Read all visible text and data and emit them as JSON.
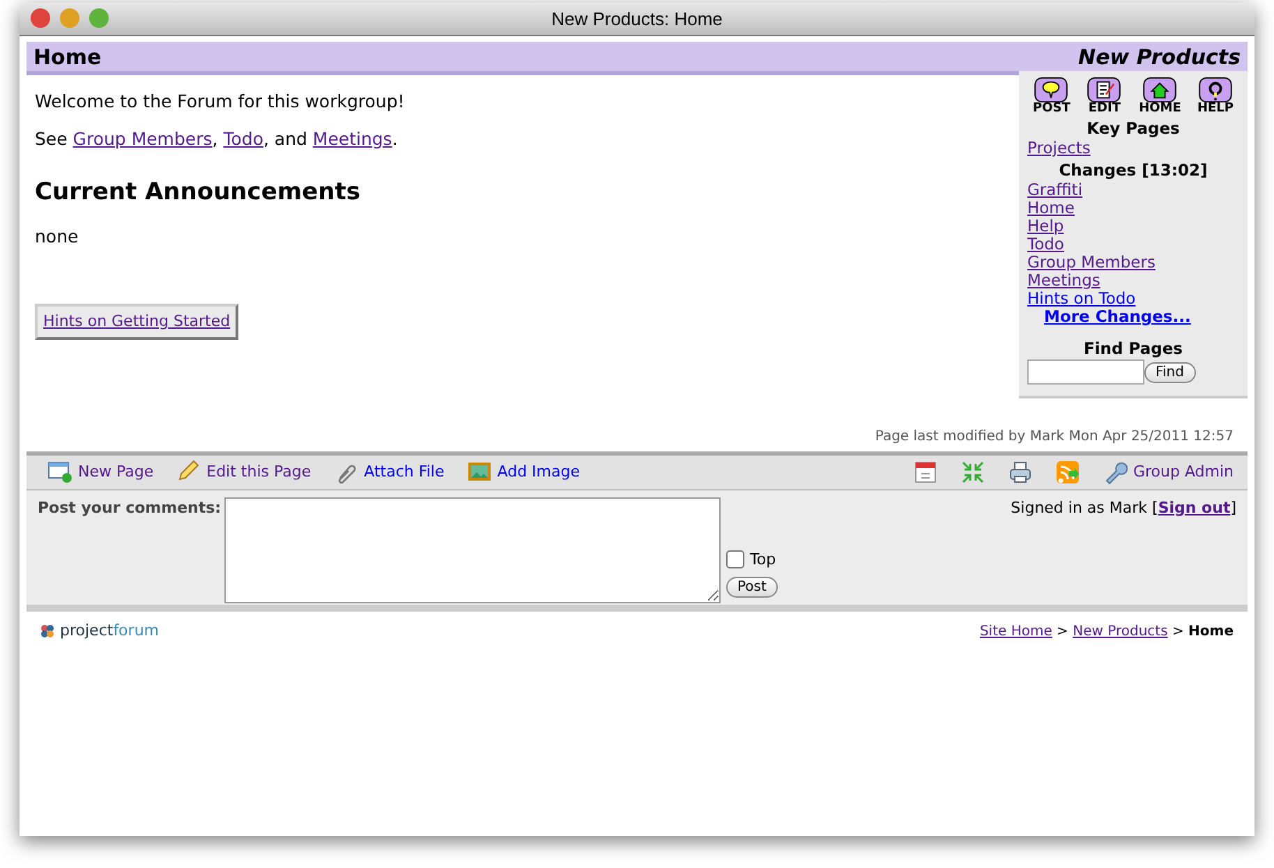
{
  "window": {
    "title": "New Products: Home"
  },
  "header": {
    "page_title": "Home",
    "forum_name": "New Products"
  },
  "welcome": "Welcome to the Forum for this workgroup!",
  "see_line": {
    "lead": "See ",
    "links": [
      {
        "text": "Group Members",
        "visited": true,
        "after": ", "
      },
      {
        "text": "Todo",
        "visited": true,
        "after": ", and "
      },
      {
        "text": "Meetings",
        "visited": true,
        "after": "."
      }
    ]
  },
  "announcements": {
    "heading": "Current Announcements",
    "body": "none"
  },
  "hints_button": "Hints on Getting Started",
  "sidebar": {
    "actions": [
      {
        "kind": "post",
        "label": "POST"
      },
      {
        "kind": "edit",
        "label": "EDIT"
      },
      {
        "kind": "home",
        "label": "HOME"
      },
      {
        "kind": "help",
        "label": "HELP"
      }
    ],
    "key_pages_heading": "Key Pages",
    "key_pages": [
      {
        "text": "Projects",
        "visited": true
      }
    ],
    "changes_heading": "Changes [13:02]",
    "changes": [
      {
        "text": "Graffiti",
        "visited": true
      },
      {
        "text": "Home",
        "visited": true
      },
      {
        "text": "Help",
        "visited": true
      },
      {
        "text": "Todo",
        "visited": true
      },
      {
        "text": "Group Members",
        "visited": true
      },
      {
        "text": "Meetings",
        "visited": true
      },
      {
        "text": "Hints on Todo",
        "visited": false
      }
    ],
    "more_changes": "More Changes...",
    "find_heading": "Find Pages",
    "find_button": "Find"
  },
  "last_modified": "Page last modified by Mark Mon Apr 25/2011 12:57",
  "toolbar": {
    "left": [
      {
        "kind": "new",
        "text": "New Page",
        "visited": true
      },
      {
        "kind": "edit",
        "text": "Edit this Page",
        "visited": true
      },
      {
        "kind": "attach",
        "text": "Attach File",
        "visited": false
      },
      {
        "kind": "image",
        "text": "Add Image",
        "visited": false
      }
    ],
    "right_icons": [
      {
        "kind": "calendar"
      },
      {
        "kind": "expand"
      },
      {
        "kind": "print"
      },
      {
        "kind": "feed"
      }
    ],
    "admin": {
      "text": "Group Admin",
      "visited": true
    }
  },
  "comments": {
    "label": "Post your comments:",
    "top_label": "Top",
    "top_checked": false,
    "post_button": "Post",
    "signed_in": "Signed in as Mark [",
    "sign_out": "Sign out",
    "signed_in_end": "]"
  },
  "footer": {
    "logo_part1": "project",
    "logo_part2": "forum",
    "breadcrumbs": [
      {
        "text": "Site Home",
        "kind": "link"
      },
      {
        "text": "New Products",
        "kind": "link"
      },
      {
        "text": "Home",
        "kind": "current"
      }
    ],
    "separator": ">"
  }
}
